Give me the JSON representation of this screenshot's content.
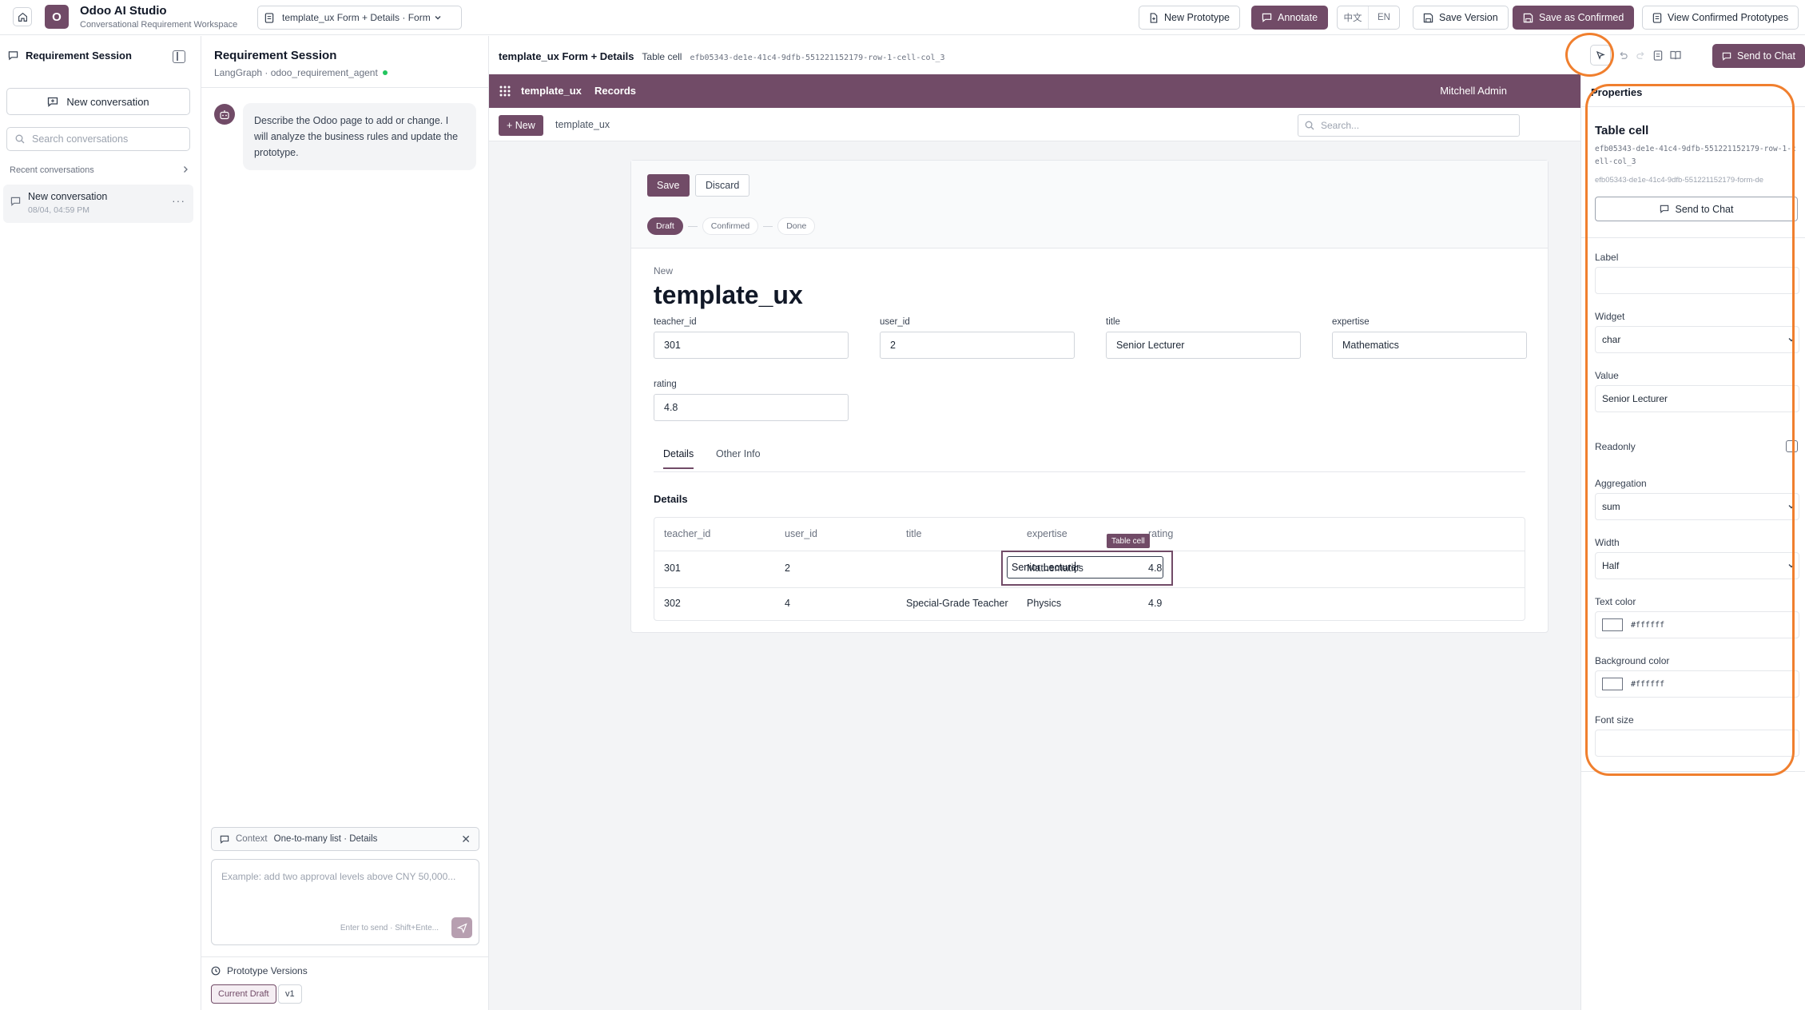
{
  "app": {
    "logo_letter": "O",
    "title": "Odoo AI Studio",
    "subtitle": "Conversational Requirement Workspace",
    "breadcrumb": "template_ux Form + Details · Form"
  },
  "toolbar": {
    "new_prototype": "New Prototype",
    "annotate": "Annotate",
    "lang_zh": "中文",
    "lang_en": "EN",
    "save_version": "Save Version",
    "save_confirmed": "Save as Confirmed",
    "view_confirmed": "View Confirmed Prototypes"
  },
  "sidebar": {
    "title": "Requirement Session",
    "new_conversation": "New conversation",
    "search_placeholder": "Search conversations",
    "recent_label": "Recent conversations",
    "conversations": [
      {
        "title": "New conversation",
        "date": "08/04, 04:59 PM"
      }
    ]
  },
  "chat": {
    "title": "Requirement Session",
    "subtitle": "LangGraph · odoo_requirement_agent",
    "messages": [
      {
        "role": "assistant",
        "text": "Describe the Odoo page to add or change. I will analyze the business rules and update the prototype."
      }
    ],
    "context_label": "Context",
    "context_value": "One-to-many list · Details",
    "input_placeholder": "Example: add two approval levels above CNY 50,000...",
    "send_hint": "Enter to send · Shift+Ente...",
    "versions_title": "Prototype Versions",
    "versions": [
      "Current Draft",
      "v1"
    ]
  },
  "canvas": {
    "title": "template_ux Form + Details",
    "selected_kind": "Table cell",
    "selected_id": "efb05343-de1e-41c4-9dfb-551221152179-row-1-cell-col_3",
    "send_to_chat": "Send to Chat"
  },
  "odoo": {
    "app_name": "template_ux",
    "menu": "Records",
    "user": "Mitchell Admin",
    "new_button": "+ New",
    "breadcrumb": "template_ux",
    "search_placeholder": "Search...",
    "save": "Save",
    "discard": "Discard",
    "statuses": [
      "Draft",
      "Confirmed",
      "Done"
    ],
    "active_status": "Draft",
    "record_label": "New",
    "record_name": "template_ux",
    "fields": [
      {
        "label": "teacher_id",
        "value": "301"
      },
      {
        "label": "user_id",
        "value": "2"
      },
      {
        "label": "title",
        "value": "Senior Lecturer"
      },
      {
        "label": "expertise",
        "value": "Mathematics"
      },
      {
        "label": "rating",
        "value": "4.8"
      }
    ],
    "tabs": [
      "Details",
      "Other Info"
    ],
    "section": "Details",
    "table": {
      "columns": [
        "teacher_id",
        "user_id",
        "title",
        "expertise",
        "rating"
      ],
      "rows": [
        [
          "301",
          "2",
          "Senior Lecturer",
          "Mathematics",
          "4.8"
        ],
        [
          "302",
          "4",
          "Special-Grade Teacher",
          "Physics",
          "4.9"
        ]
      ],
      "selected_tag": "Table cell"
    }
  },
  "properties": {
    "title": "Properties",
    "kind": "Table cell",
    "id": "efb05343-de1e-41c4-9dfb-551221152179-row-1-cell-col_3",
    "parent_id": "efb05343-de1e-41c4-9dfb-551221152179-form-de",
    "send_to_chat": "Send to Chat",
    "label_label": "Label",
    "label_value": "",
    "widget_label": "Widget",
    "widget_value": "char",
    "value_label": "Value",
    "value_value": "Senior Lecturer",
    "readonly_label": "Readonly",
    "aggregation_label": "Aggregation",
    "aggregation_value": "sum",
    "width_label": "Width",
    "width_value": "Half",
    "text_color_label": "Text color",
    "text_color_value": "#ffffff",
    "bg_color_label": "Background color",
    "bg_color_value": "#ffffff",
    "font_size_label": "Font size",
    "font_size_value": ""
  },
  "colors": {
    "brand": "#714b67",
    "annotation": "#f07f2e"
  }
}
